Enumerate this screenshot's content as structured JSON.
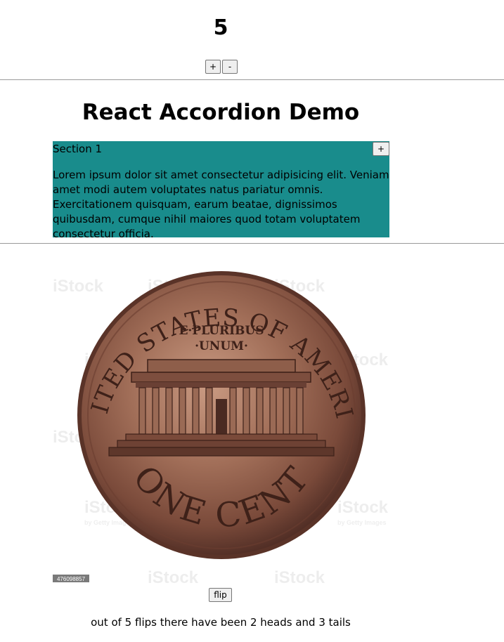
{
  "counter": {
    "value": "5",
    "increment_label": "+",
    "decrement_label": "-"
  },
  "accordion": {
    "title": "React Accordion Demo",
    "panel_color": "#198c8c",
    "sections": [
      {
        "label": "Section 1",
        "toggle_label": "+",
        "body": "Lorem ipsum dolor sit amet consectetur adipisicing elit. Veniam amet modi autem voluptates natus pariatur omnis. Exercitationem quisquam, earum beatae, dignissimos quibusdam, cumque nihil maiores quod totam voluptatem consectetur officia."
      }
    ]
  },
  "coin": {
    "top_legend": "UNITED STATES OF AMERICA",
    "motto_line1": "E·PLURIBUS",
    "motto_line2": "·UNUM·",
    "denomination": "ONE CENT",
    "watermark": "iStock",
    "watermark_sub": "by Getty Images",
    "stock_id": "476098857"
  },
  "flip": {
    "button_label": "flip",
    "result_text": "out of 5 flips there have been 2 heads and 3 tails"
  }
}
